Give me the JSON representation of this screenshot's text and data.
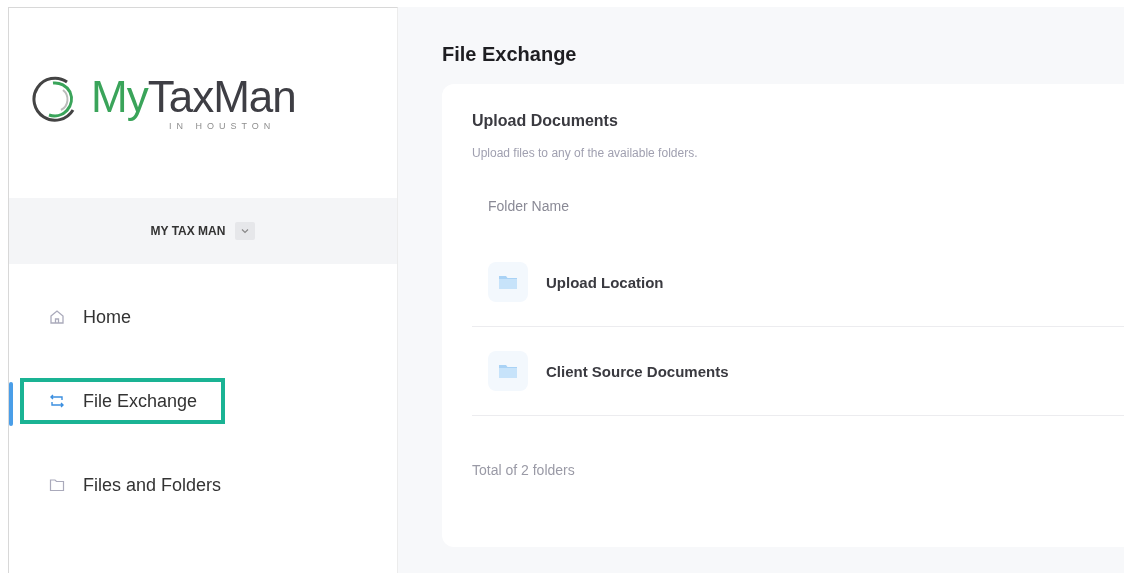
{
  "sidebar": {
    "logo": {
      "primary": "My",
      "secondary": "TaxMan",
      "tagline": "IN HOUSTON"
    },
    "account": {
      "name": "MY TAX MAN"
    },
    "items": [
      {
        "label": "Home",
        "selected": false,
        "highlighted": false
      },
      {
        "label": "File Exchange",
        "selected": true,
        "highlighted": true
      },
      {
        "label": "Files and Folders",
        "selected": false,
        "highlighted": false
      }
    ]
  },
  "page": {
    "title": "File Exchange",
    "card": {
      "title": "Upload Documents",
      "subtitle": "Upload files to any of the available folders.",
      "table": {
        "columns": [
          "Folder Name"
        ],
        "rows": [
          {
            "name": "Upload Location"
          },
          {
            "name": "Client Source Documents"
          }
        ]
      },
      "footer": "Total of 2 folders"
    }
  }
}
